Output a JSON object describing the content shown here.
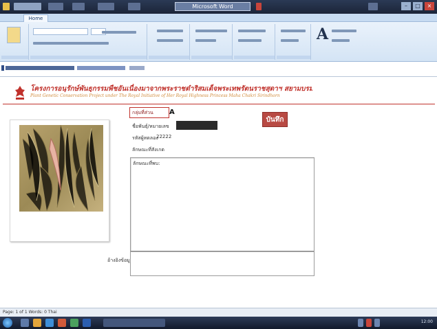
{
  "window": {
    "title": "Microsoft Word",
    "controls": [
      "–",
      "□",
      "×"
    ],
    "ribbon_tab": "Home"
  },
  "ribbon": {
    "font_icon": "A"
  },
  "address": {
    "icon": "page-icon"
  },
  "header": {
    "title": "โครงการอนุรักษ์พันธุกรรมพืชอันเนื่องมาจากพระราชดำริสมเด็จพระเทพรัตนราชสุดาฯ สยามบรมราชกุมารี",
    "subtitle": "Plant Genetic Conservation Project under The Royal Initiative of Her Royal Highness Princess Maha Chakri Sirindhorn"
  },
  "form": {
    "group_label": "กลุ่มที่ส่วน",
    "group_value": "A",
    "register_label": "ชื่อพันธุ์/หมายเลข",
    "code_label": "รหัสผู้ทดลอง",
    "code_value": "22222",
    "description_label": "ลักษณะที่สังเกต",
    "description_text": "ลักษณะที่พบ:",
    "reference_label": "อ้างอิงข้อมูล",
    "save_button": "บันทึก"
  },
  "status": {
    "text": "Page: 1 of 1  Words: 0  Thai"
  },
  "taskbar": {
    "clock": "12:00"
  },
  "colors": {
    "accent": "#c0312b",
    "button": "#b84a43",
    "ribbon": "#d4e4f5"
  }
}
